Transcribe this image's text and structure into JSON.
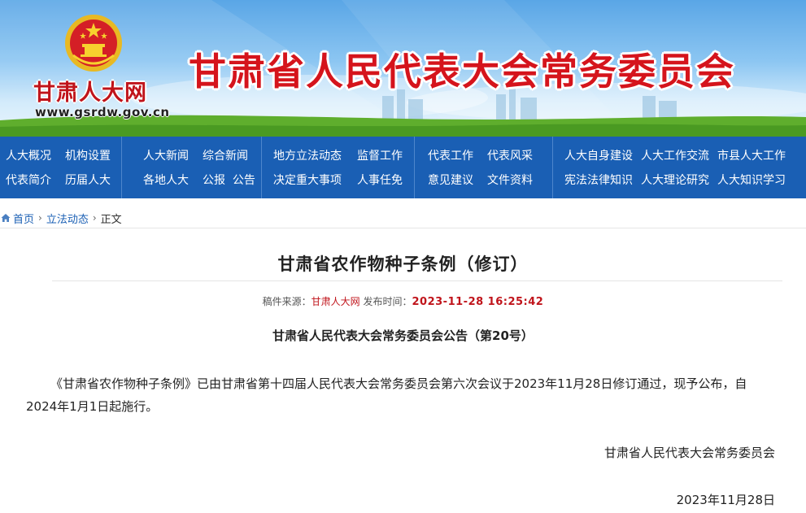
{
  "banner": {
    "logo_text": "甘肃人大网",
    "logo_url": "www.gsrdw.gov.cn",
    "site_title": "甘肃省人民代表大会常务委员会"
  },
  "nav": {
    "groups": [
      {
        "row1": [
          "人大概况",
          "机构设置"
        ],
        "row2": [
          "代表简介",
          "历届人大"
        ]
      },
      {
        "row1": [
          "人大新闻",
          "综合新闻"
        ],
        "row2": [
          "各地人大",
          "公报  公告"
        ]
      },
      {
        "row1": [
          "地方立法动态",
          "监督工作"
        ],
        "row2": [
          "决定重大事项",
          "人事任免"
        ]
      },
      {
        "row1": [
          "代表工作",
          "代表风采"
        ],
        "row2": [
          "意见建议",
          "文件资料"
        ]
      },
      {
        "row1": [
          "人大自身建设",
          "人大工作交流",
          "市县人大工作"
        ],
        "row2": [
          "宪法法律知识",
          "人大理论研究",
          "人大知识学习"
        ]
      }
    ]
  },
  "breadcrumb": {
    "home": "首页",
    "section": "立法动态",
    "current": "正文"
  },
  "article": {
    "title": "甘肃省农作物种子条例（修订）",
    "source_label": "稿件来源：",
    "source": "甘肃人大网",
    "time_label": " 发布时间：",
    "time": "2023-11-28 16:25:42",
    "subhead": "甘肃省人民代表大会常务委员会公告（第20号）",
    "body": "《甘肃省农作物种子条例》已由甘肃省第十四届人民代表大会常务委员会第六次会议于2023年11月28日修订通过，现予公布，自2024年1月1日起施行。",
    "sign_org": "甘肃省人民代表大会常务委员会",
    "sign_date": "2023年11月28日"
  },
  "colors": {
    "nav_bg": "#1a5fb4",
    "title_red": "#d5141c",
    "accent_red": "#c0141b",
    "link_blue": "#1a5fb4"
  },
  "icons": {
    "breadcrumb_home": "home-icon",
    "emblem": "national-emblem-icon"
  }
}
